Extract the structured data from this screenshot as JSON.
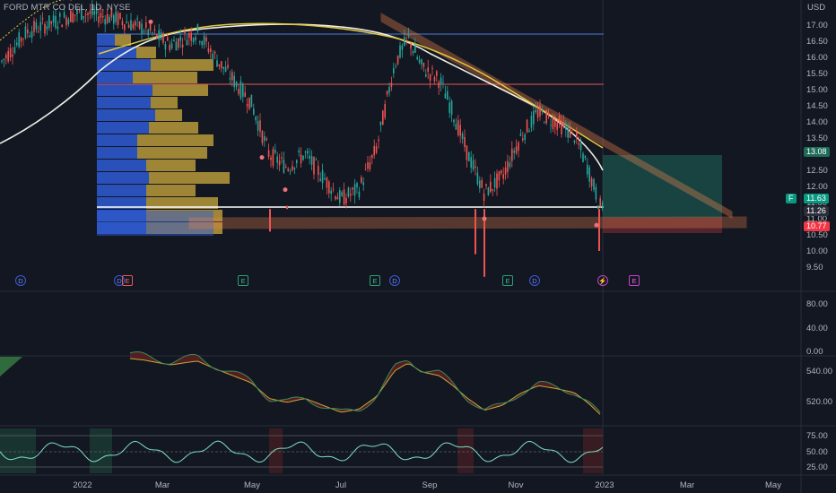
{
  "symbol": "FORD MTR CO DEL, 1D, NYSE",
  "currency": "USD",
  "colors": {
    "background": "#131722",
    "up": "#26a69a",
    "down": "#ef5350",
    "triangle": "#f4864f",
    "ma_yellow": "#e2c93f",
    "ma_white": "#f0f0e8",
    "vp_blue": "#2f5bd3",
    "vp_gold": "#b8993a",
    "target_zone": "#1f7a69"
  },
  "price_axis": {
    "ticks": [
      "17.00",
      "16.50",
      "16.00",
      "15.50",
      "15.00",
      "14.50",
      "14.00",
      "13.50",
      "13.00",
      "12.50",
      "12.00",
      "11.50",
      "11.00",
      "10.50",
      "10.00",
      "9.50"
    ],
    "badges": [
      {
        "value": "13.08",
        "bg": "#1e6b58",
        "fg": "#ffffff"
      },
      {
        "value": "11.63",
        "bg": "#089981",
        "fg": "#ffffff",
        "prefix": "F"
      },
      {
        "value": "11.26",
        "bg": "#2a2e39",
        "fg": "#ffffff"
      },
      {
        "value": "10.77",
        "bg": "#f23645",
        "fg": "#ffffff"
      }
    ]
  },
  "panes": {
    "rsi_ticks": [
      "80.00",
      "40.00",
      "0.00"
    ],
    "osc_ticks": [
      "540.00",
      "520.00"
    ],
    "bottom_ticks": [
      "75.00",
      "50.00",
      "25.00"
    ]
  },
  "time_axis": [
    "2022",
    "Mar",
    "May",
    "Jul",
    "Sep",
    "Nov",
    "2023",
    "Mar",
    "May"
  ],
  "events": [
    {
      "label": "D",
      "type": "div"
    },
    {
      "label": "D",
      "type": "div"
    },
    {
      "label": "E",
      "type": "earn-red"
    },
    {
      "label": "E",
      "type": "earn"
    },
    {
      "label": "E",
      "type": "earn"
    },
    {
      "label": "D",
      "type": "div"
    },
    {
      "label": "E",
      "type": "earn"
    },
    {
      "label": "D",
      "type": "div"
    },
    {
      "label": "⚡",
      "type": "bolt"
    },
    {
      "label": "E",
      "type": "earn-mag"
    }
  ]
}
